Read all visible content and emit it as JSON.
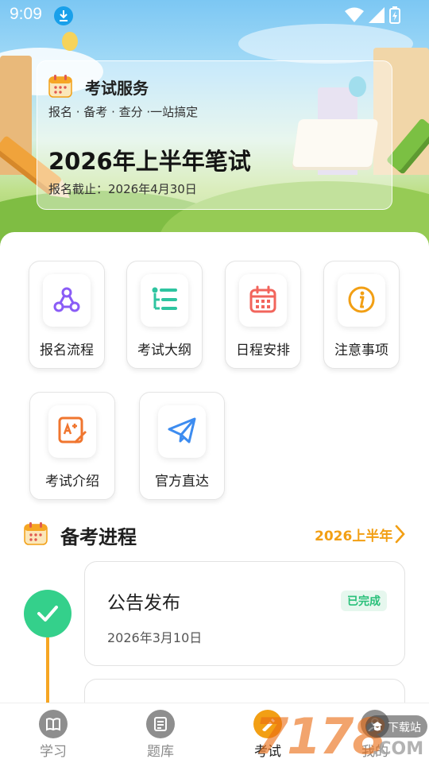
{
  "status_bar": {
    "time": "9:09"
  },
  "hero": {
    "service_title": "考试服务",
    "service_subtitle": "报名 · 备考 · 查分 ·一站搞定",
    "exam_title": "2026年上半年笔试",
    "deadline": "报名截止：2026年4月30日"
  },
  "tiles": [
    {
      "label": "报名流程",
      "icon": "flow-icon",
      "color": "#8a5cf6"
    },
    {
      "label": "考试大纲",
      "icon": "outline-list-icon",
      "color": "#2ec4a0"
    },
    {
      "label": "日程安排",
      "icon": "calendar-icon",
      "color": "#f2655c"
    },
    {
      "label": "注意事项",
      "icon": "info-icon",
      "color": "#f29f14"
    },
    {
      "label": "考试介绍",
      "icon": "exam-intro-icon",
      "color": "#f0762f"
    },
    {
      "label": "官方直达",
      "icon": "paper-plane-icon",
      "color": "#3d8cf0"
    }
  ],
  "progress": {
    "title": "备考进程",
    "period": "2026上半年",
    "steps": [
      {
        "title": "公告发布",
        "status": "已完成",
        "date": "2026年3月10日"
      }
    ]
  },
  "nav": [
    {
      "label": "学习",
      "icon": "book-icon",
      "active": false
    },
    {
      "label": "题库",
      "icon": "question-bank-icon",
      "active": false
    },
    {
      "label": "考试",
      "icon": "exam-icon",
      "active": true
    },
    {
      "label": "我的",
      "icon": "profile-icon",
      "active": false
    }
  ],
  "watermark": {
    "text": "7178",
    "badge": "下载站",
    "suffix": ".COM"
  },
  "colors": {
    "accent": "#f29f14",
    "success": "#34d08b",
    "success_text": "#29c07a"
  }
}
